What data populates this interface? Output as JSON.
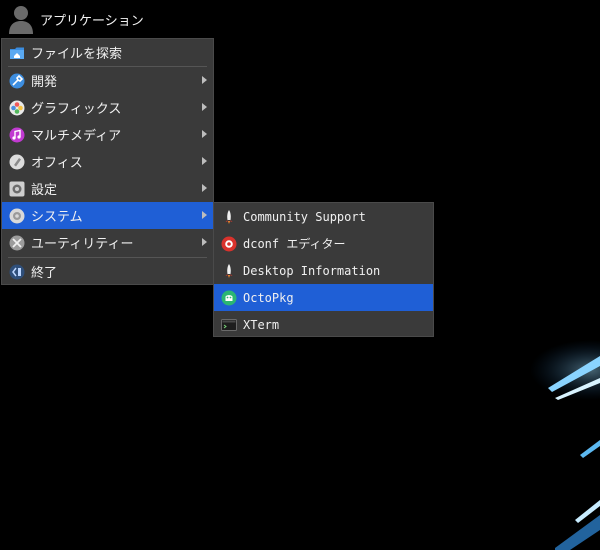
{
  "panel": {
    "launcher_label": "アプリケーション"
  },
  "main_menu": {
    "items": [
      {
        "label": "ファイルを探索",
        "icon": "folder-home-icon",
        "submenu": false
      },
      {
        "label": "開発",
        "icon": "development-icon",
        "submenu": true
      },
      {
        "label": "グラフィックス",
        "icon": "graphics-icon",
        "submenu": true
      },
      {
        "label": "マルチメディア",
        "icon": "multimedia-icon",
        "submenu": true
      },
      {
        "label": "オフィス",
        "icon": "office-icon",
        "submenu": true
      },
      {
        "label": "設定",
        "icon": "settings-icon",
        "submenu": true
      },
      {
        "label": "システム",
        "icon": "system-icon",
        "submenu": true,
        "active": true
      },
      {
        "label": "ユーティリティー",
        "icon": "utilities-icon",
        "submenu": true
      },
      {
        "label": "終了",
        "icon": "logout-icon",
        "submenu": false
      }
    ]
  },
  "system_submenu": {
    "items": [
      {
        "label": "Community Support",
        "icon": "rocket-icon"
      },
      {
        "label": "dconf エディター",
        "icon": "dconf-editor-icon"
      },
      {
        "label": "Desktop Information",
        "icon": "rocket-icon"
      },
      {
        "label": "OctoPkg",
        "icon": "octopkg-icon",
        "active": true
      },
      {
        "label": "XTerm",
        "icon": "terminal-icon"
      }
    ]
  },
  "colors": {
    "menu_bg": "#3a3a3a",
    "highlight": "#1f5fd6",
    "desktop_bg": "#000000",
    "accent_light": "#4fb4ff"
  }
}
